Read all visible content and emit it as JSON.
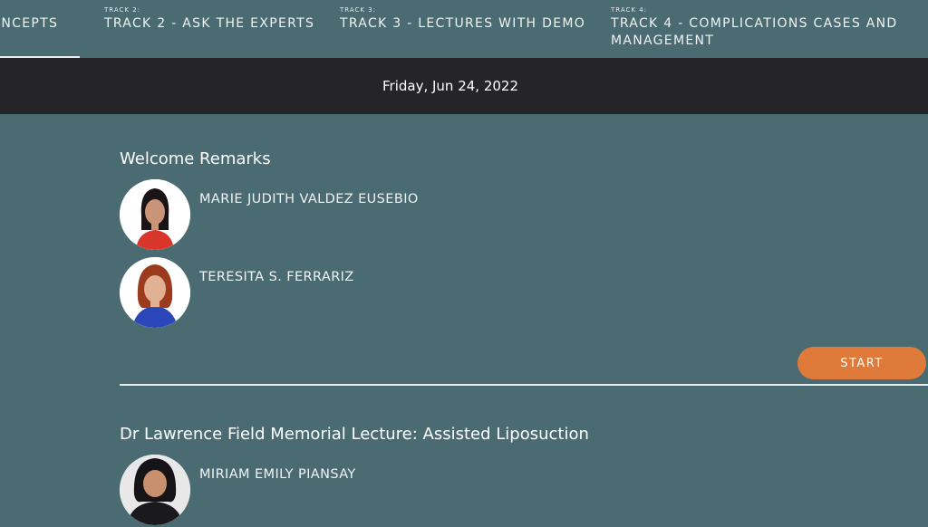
{
  "tabs": [
    {
      "number": "",
      "label": "CONCEPTS"
    },
    {
      "number": "TRACK 2:",
      "label": "TRACK 2 - ASK THE EXPERTS"
    },
    {
      "number": "TRACK 3:",
      "label": "TRACK 3 - LECTURES WITH DEMO"
    },
    {
      "number": "TRACK 4:",
      "label_line1": "TRACK 4 - COMPLICATIONS CASES AND",
      "label_line2": "MANAGEMENT"
    }
  ],
  "date": "Friday, Jun 24, 2022",
  "sessions": [
    {
      "title": "Welcome Remarks",
      "speakers": [
        {
          "name": "MARIE JUDITH VALDEZ EUSEBIO"
        },
        {
          "name": "TERESITA S. FERRARIZ"
        }
      ],
      "button": "START"
    },
    {
      "title": "Dr Lawrence Field Memorial Lecture: Assisted Liposuction",
      "speakers": [
        {
          "name": "MIRIAM EMILY PIANSAY"
        }
      ]
    }
  ]
}
